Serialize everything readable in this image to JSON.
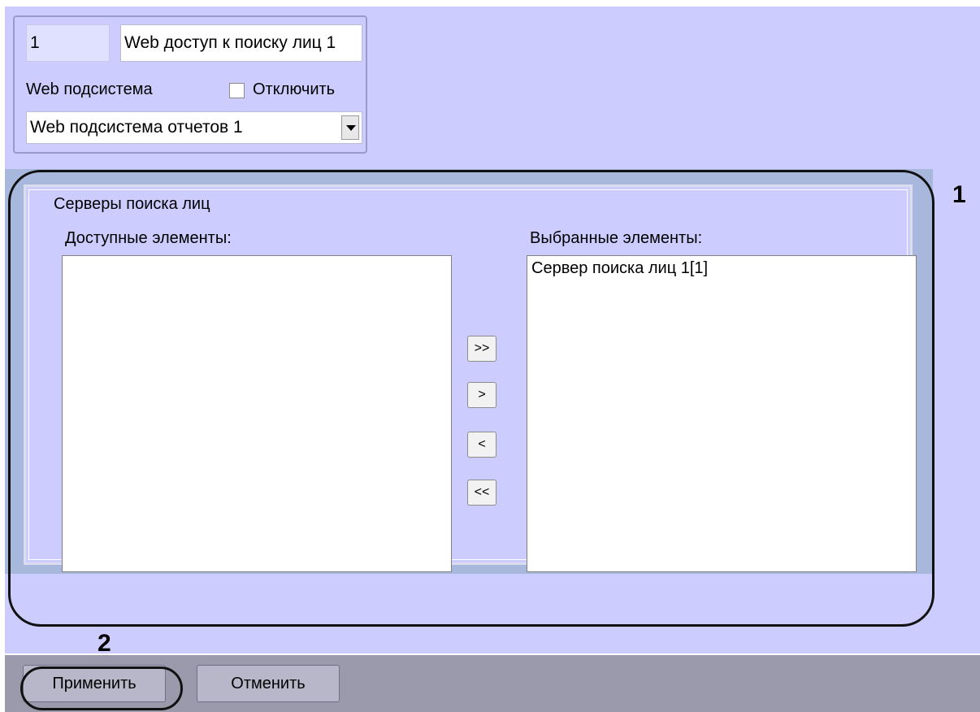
{
  "header": {
    "id_value": "1",
    "name_value": "Web доступ к поиску лиц 1",
    "subsystem_label": "Web подсистема",
    "disable_label": "Отключить",
    "disable_checked": false,
    "subsystem_value": "Web подсистема отчетов 1"
  },
  "servers": {
    "title": "Серверы поиска лиц",
    "available_label": "Доступные элементы:",
    "available_items": [],
    "selected_label": "Выбранные элементы:",
    "selected_items": [
      "Сервер поиска лиц 1[1]"
    ],
    "buttons": {
      "add_all": ">>",
      "add": ">",
      "remove": "<",
      "remove_all": "<<"
    }
  },
  "footer": {
    "apply_label": "Применить",
    "cancel_label": "Отменить"
  },
  "annotations": {
    "marker_1": "1",
    "marker_2": "2"
  },
  "colors": {
    "panel_bg": "#ccccff",
    "band_bg": "#a8b8dc",
    "footer_bg": "#9a9aac",
    "button_bg": "#b7b7c9"
  }
}
